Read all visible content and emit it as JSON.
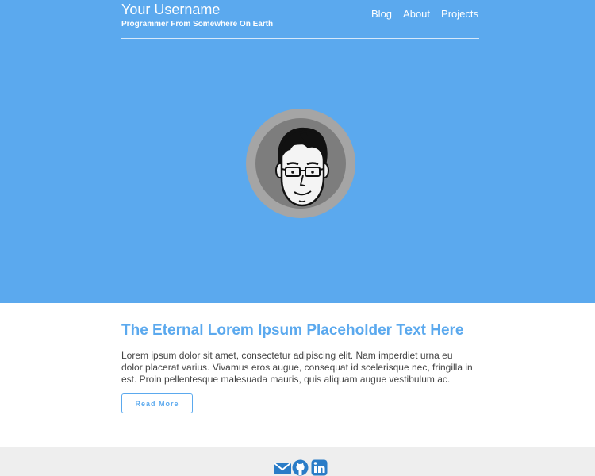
{
  "header": {
    "username": "Your Username",
    "tagline": "Programmer From Somewhere On Earth",
    "nav": [
      {
        "label": "Blog"
      },
      {
        "label": "About"
      },
      {
        "label": "Projects"
      }
    ]
  },
  "avatar": {
    "icon": "cartoon-face-with-glasses"
  },
  "post": {
    "title": "The Eternal Lorem Ipsum Placeholder Text Here",
    "body": "Lorem ipsum dolor sit amet, consectetur adipiscing elit. Nam imperdiet urna eu dolor placerat varius. Vivamus eros augue, consequat id scelerisque nec, fringilla in est. Proin pellentesque malesuada mauris, quis aliquam augue vestibulum ac.",
    "read_more_label": "Read More"
  },
  "footer": {
    "social": [
      {
        "icon": "envelope-icon"
      },
      {
        "icon": "github-icon"
      },
      {
        "icon": "linkedin-icon"
      }
    ]
  },
  "colors": {
    "accent": "#5ba9ee",
    "footer_bg": "#eeeeee",
    "text": "#444444"
  }
}
